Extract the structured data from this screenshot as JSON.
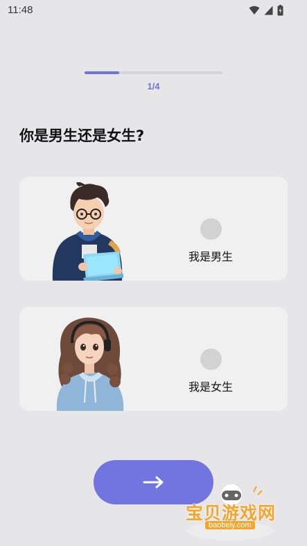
{
  "status_bar": {
    "time": "11:48",
    "icons": [
      "wifi-icon",
      "cell-signal-icon",
      "battery-icon"
    ]
  },
  "progress": {
    "label": "1/4",
    "fraction": 0.25,
    "accent_color": "#6f72db"
  },
  "question": "你是男生还是女生?",
  "options": [
    {
      "label": "我是男生",
      "avatar": "boy-avatar",
      "selected": false
    },
    {
      "label": "我是女生",
      "avatar": "girl-avatar",
      "selected": false
    }
  ],
  "next_button": {
    "icon": "arrow-right-icon",
    "color": "#7275e0"
  },
  "watermark": {
    "text": "宝贝游戏网",
    "url": "baobeiy.com"
  }
}
